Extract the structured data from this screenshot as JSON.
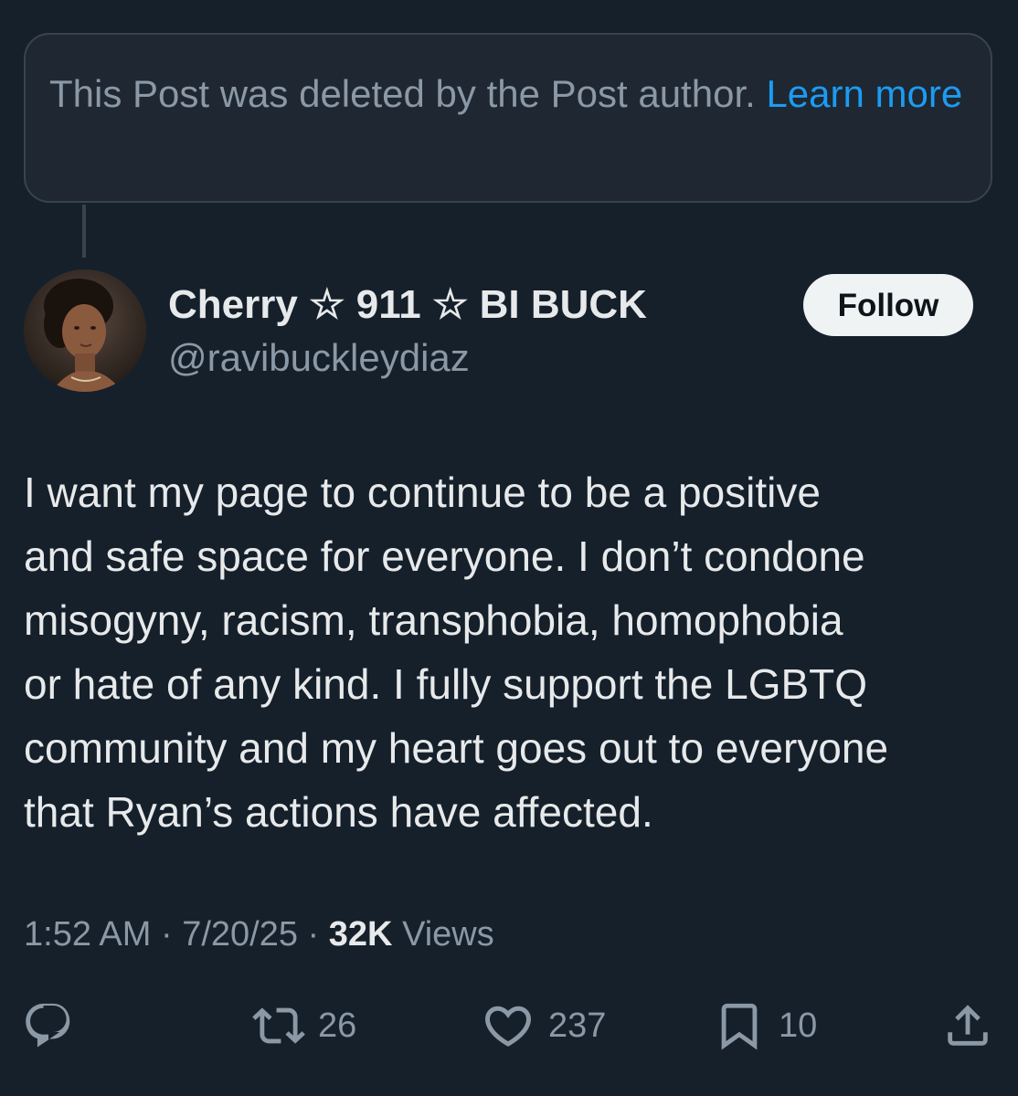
{
  "deleted_notice": {
    "text": "This Post was deleted by the Post author.",
    "link": "Learn more"
  },
  "author": {
    "display_name": "Cherry ☆ 911 ☆ BI BUCK",
    "handle": "@ravibuckleydiaz",
    "avatar_icon": "avatar-photo"
  },
  "follow_button": {
    "label": "Follow"
  },
  "post": {
    "lines": [
      "I want my page to continue to be a positive",
      "and safe space for everyone. I don’t condone",
      "misogyny, racism, transphobia, homophobia",
      "or hate of any kind. I fully support the LGBTQ",
      "community and my heart goes out to everyone",
      "that Ryan’s actions have affected."
    ]
  },
  "meta": {
    "time": "1:52 AM",
    "separator": " · ",
    "date": "7/20/25",
    "views_count": "32K",
    "views_label": "Views"
  },
  "actions": {
    "reply": {
      "icon": "reply-icon",
      "count": ""
    },
    "repost": {
      "icon": "repost-icon",
      "count": "26"
    },
    "like": {
      "icon": "heart-icon",
      "count": "237"
    },
    "bookmark": {
      "icon": "bookmark-icon",
      "count": "10"
    },
    "share": {
      "icon": "share-icon",
      "count": ""
    }
  },
  "colors": {
    "background": "#15202b",
    "accent": "#1d9bf0",
    "text_primary": "#e7e9ea",
    "text_secondary": "#8b98a5",
    "border": "#38444d"
  }
}
